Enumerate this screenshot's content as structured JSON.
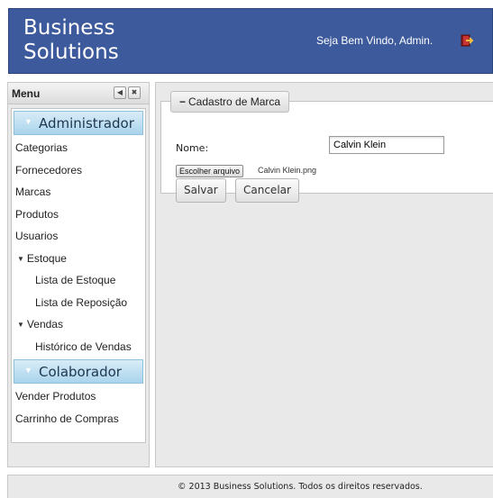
{
  "header": {
    "brand_line1": "Business",
    "brand_line2": "Solutions",
    "welcome": "Seja Bem Vindo, Admin.",
    "logout_icon": "logout-door-icon"
  },
  "sidebar": {
    "title": "Menu",
    "sections": {
      "admin": "Administrador",
      "colab": "Colaborador"
    },
    "admin_items": [
      "Categorias",
      "Fornecedores",
      "Marcas",
      "Produtos",
      "Usuarios"
    ],
    "estoque": {
      "label": "Estoque",
      "items": [
        "Lista de Estoque",
        "Lista de Reposição"
      ]
    },
    "vendas": {
      "label": "Vendas",
      "items": [
        "Histórico de Vendas"
      ]
    },
    "colab_items": [
      "Vender Produtos",
      "Carrinho de Compras"
    ]
  },
  "form": {
    "legend": "Cadastro de Marca",
    "nome_label": "Nome:",
    "nome_value": "Calvin Klein",
    "file_button": "Escolher arquivo",
    "file_name": "Calvin Klein.png",
    "save": "Salvar",
    "cancel": "Cancelar"
  },
  "footer": {
    "text": "© 2013 Business Solutions. Todos os direitos reservados."
  },
  "colors": {
    "header_bg": "#3d5a9c",
    "section_bg": "#a9d4ec",
    "panel_bg": "#e9e9e9"
  }
}
